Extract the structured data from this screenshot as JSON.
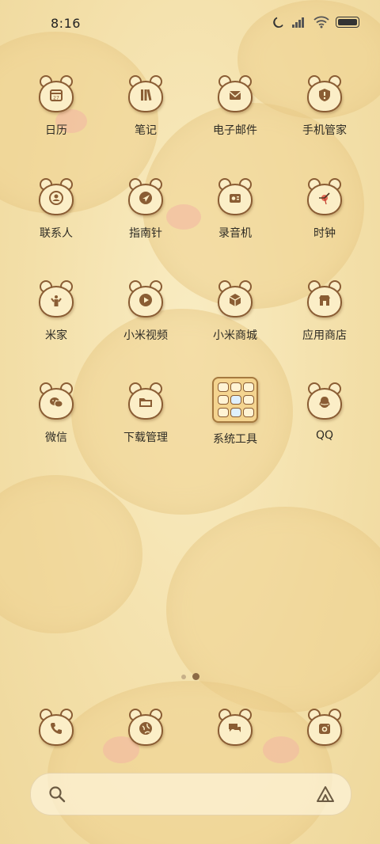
{
  "status_bar": {
    "time": "8:16"
  },
  "apps": [
    {
      "label": "日历",
      "icon": "calendar-icon"
    },
    {
      "label": "笔记",
      "icon": "notes-icon"
    },
    {
      "label": "电子邮件",
      "icon": "mail-icon"
    },
    {
      "label": "手机管家",
      "icon": "shield-icon"
    },
    {
      "label": "联系人",
      "icon": "contacts-icon"
    },
    {
      "label": "指南针",
      "icon": "compass-icon"
    },
    {
      "label": "录音机",
      "icon": "recorder-icon"
    },
    {
      "label": "时钟",
      "icon": "clock-icon"
    },
    {
      "label": "米家",
      "icon": "mihome-icon"
    },
    {
      "label": "小米视频",
      "icon": "video-icon"
    },
    {
      "label": "小米商城",
      "icon": "store-box-icon"
    },
    {
      "label": "应用商店",
      "icon": "app-store-icon"
    },
    {
      "label": "微信",
      "icon": "wechat-icon"
    },
    {
      "label": "下载管理",
      "icon": "folder-download-icon"
    },
    {
      "label": "系统工具",
      "icon": "system-tools-folder-icon"
    },
    {
      "label": "QQ",
      "icon": "qq-icon"
    }
  ],
  "page_indicator": {
    "pages": 2,
    "current": 2
  },
  "dock": [
    {
      "icon": "phone-icon"
    },
    {
      "icon": "browser-icon"
    },
    {
      "icon": "messages-icon"
    },
    {
      "icon": "camera-icon"
    }
  ],
  "colors": {
    "icon_outline": "#8a5d34",
    "icon_fill": "#fbeec7",
    "background": "#f6e6b6"
  }
}
